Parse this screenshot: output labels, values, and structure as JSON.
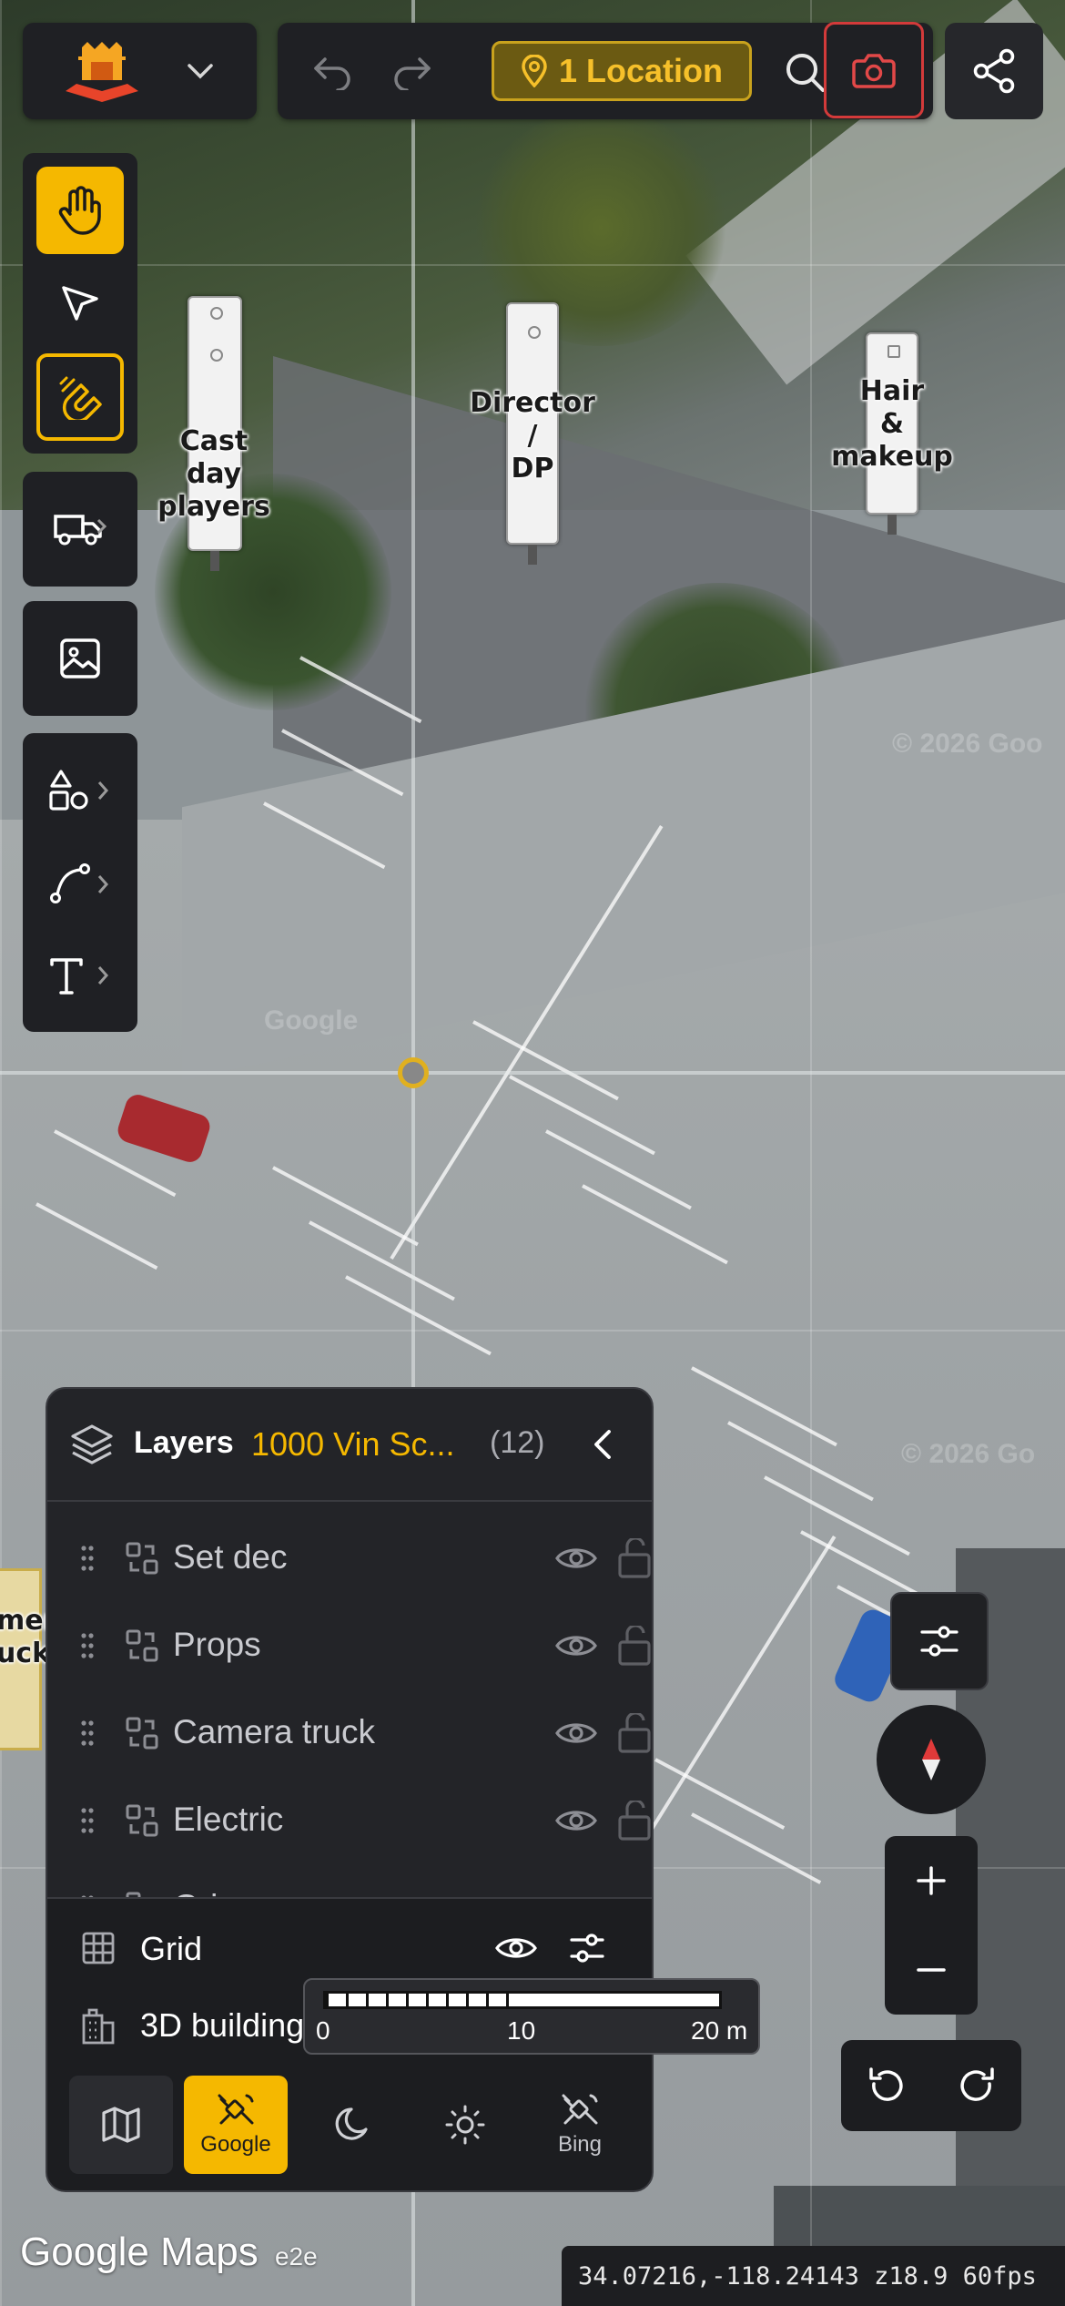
{
  "toolbar_top": {
    "location_label": "1 Location"
  },
  "map": {
    "labels": {
      "cast": [
        "Cast",
        "day",
        "players"
      ],
      "director": [
        "Director",
        "/",
        "DP"
      ],
      "hair": [
        "Hair",
        "&",
        "makeup"
      ],
      "camera_truck_partial": [
        "mera",
        "uck"
      ]
    },
    "watermarks": [
      "© 2026 Goo",
      "Google",
      "© 2026 Go"
    ]
  },
  "layers": {
    "title": "Layers",
    "location": "1000 Vin Sc...",
    "count": "(12)",
    "items": [
      {
        "label": "Set dec"
      },
      {
        "label": "Props"
      },
      {
        "label": "Camera truck"
      },
      {
        "label": "Electric"
      },
      {
        "label": "Grips"
      }
    ],
    "grid_label": "Grid",
    "buildings_label": "3D buildings",
    "basemaps": [
      {
        "label": "",
        "icon": "map-icon"
      },
      {
        "label": "Google",
        "icon": "satellite-icon",
        "active": true
      },
      {
        "label": "",
        "icon": "moon-icon"
      },
      {
        "label": "",
        "icon": "sun-icon"
      },
      {
        "label": "Bing",
        "icon": "satellite-icon"
      }
    ]
  },
  "scale": {
    "ticks": [
      "0",
      "10",
      "20 m"
    ]
  },
  "footer": {
    "attribution_brand": "Google Maps",
    "attribution_suffix": "e2e",
    "coords": "34.07216,-118.24143 z18.9 60fps"
  },
  "colors": {
    "accent": "#f5b800",
    "panel": "#1f2024",
    "danger": "#d33a3a"
  }
}
